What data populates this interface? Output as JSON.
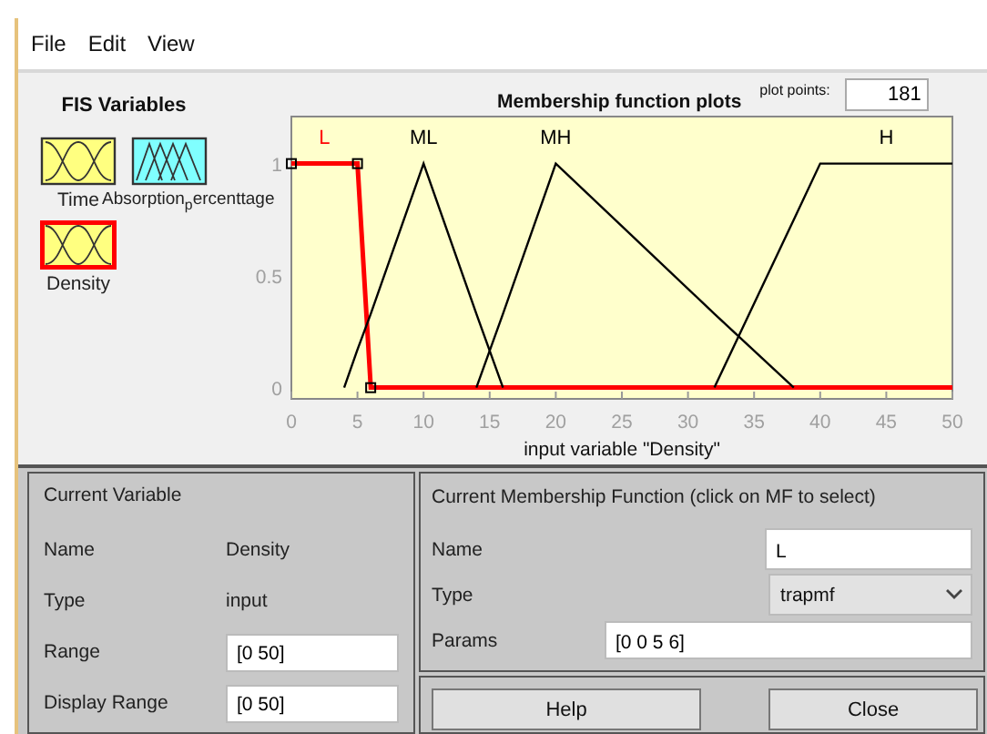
{
  "menu": [
    "File",
    "Edit",
    "View"
  ],
  "fis_variables": {
    "title": "FIS Variables",
    "items": [
      {
        "name": "Time",
        "kind": "input",
        "selected": false
      },
      {
        "name": "Absorption$_{p}$ercenttage",
        "kind": "output",
        "selected": false
      },
      {
        "name": "Density",
        "kind": "input",
        "selected": true
      }
    ]
  },
  "plot": {
    "title": "Membership function plots",
    "plot_points_label": "plot points:",
    "plot_points": "181",
    "chart_data": {
      "type": "line",
      "xlabel": "input variable \"Density\"",
      "x": [
        0,
        4,
        5,
        6,
        10,
        14,
        16,
        20,
        32,
        38,
        40,
        50
      ],
      "series": [
        {
          "name": "L",
          "color": "#ff0000",
          "values": [
            1,
            1,
            1,
            0,
            0,
            0,
            0,
            0,
            0,
            0,
            0,
            0
          ]
        },
        {
          "name": "ML",
          "color": "#000000",
          "values": [
            null,
            0,
            0.17,
            0.33,
            1,
            0.33,
            0,
            null,
            null,
            null,
            null,
            null
          ]
        },
        {
          "name": "MH",
          "color": "#000000",
          "values": [
            null,
            null,
            null,
            null,
            null,
            0,
            0.33,
            1,
            0.33,
            0,
            null,
            null
          ]
        },
        {
          "name": "H",
          "color": "#000000",
          "values": [
            null,
            null,
            null,
            null,
            null,
            null,
            null,
            null,
            0,
            0.75,
            1,
            1
          ]
        }
      ],
      "xlim": [
        0,
        50
      ],
      "ylim": [
        -0.05,
        1.21
      ],
      "xticks": [
        0,
        5,
        10,
        15,
        20,
        25,
        30,
        35,
        40,
        45,
        50
      ],
      "yticks": [
        0,
        0.5,
        1
      ]
    }
  },
  "current_variable": {
    "title": "Current Variable",
    "name_label": "Name",
    "name": "Density",
    "type_label": "Type",
    "type": "input",
    "range_label": "Range",
    "range": "[0 50]",
    "display_range_label": "Display Range",
    "display_range": "[0 50]"
  },
  "current_mf": {
    "title": "Current Membership Function (click on MF to select)",
    "name_label": "Name",
    "name": "L",
    "type_label": "Type",
    "type": "trapmf",
    "params_label": "Params",
    "params": "[0 0 5 6]"
  },
  "buttons": [
    "Help",
    "Close"
  ]
}
